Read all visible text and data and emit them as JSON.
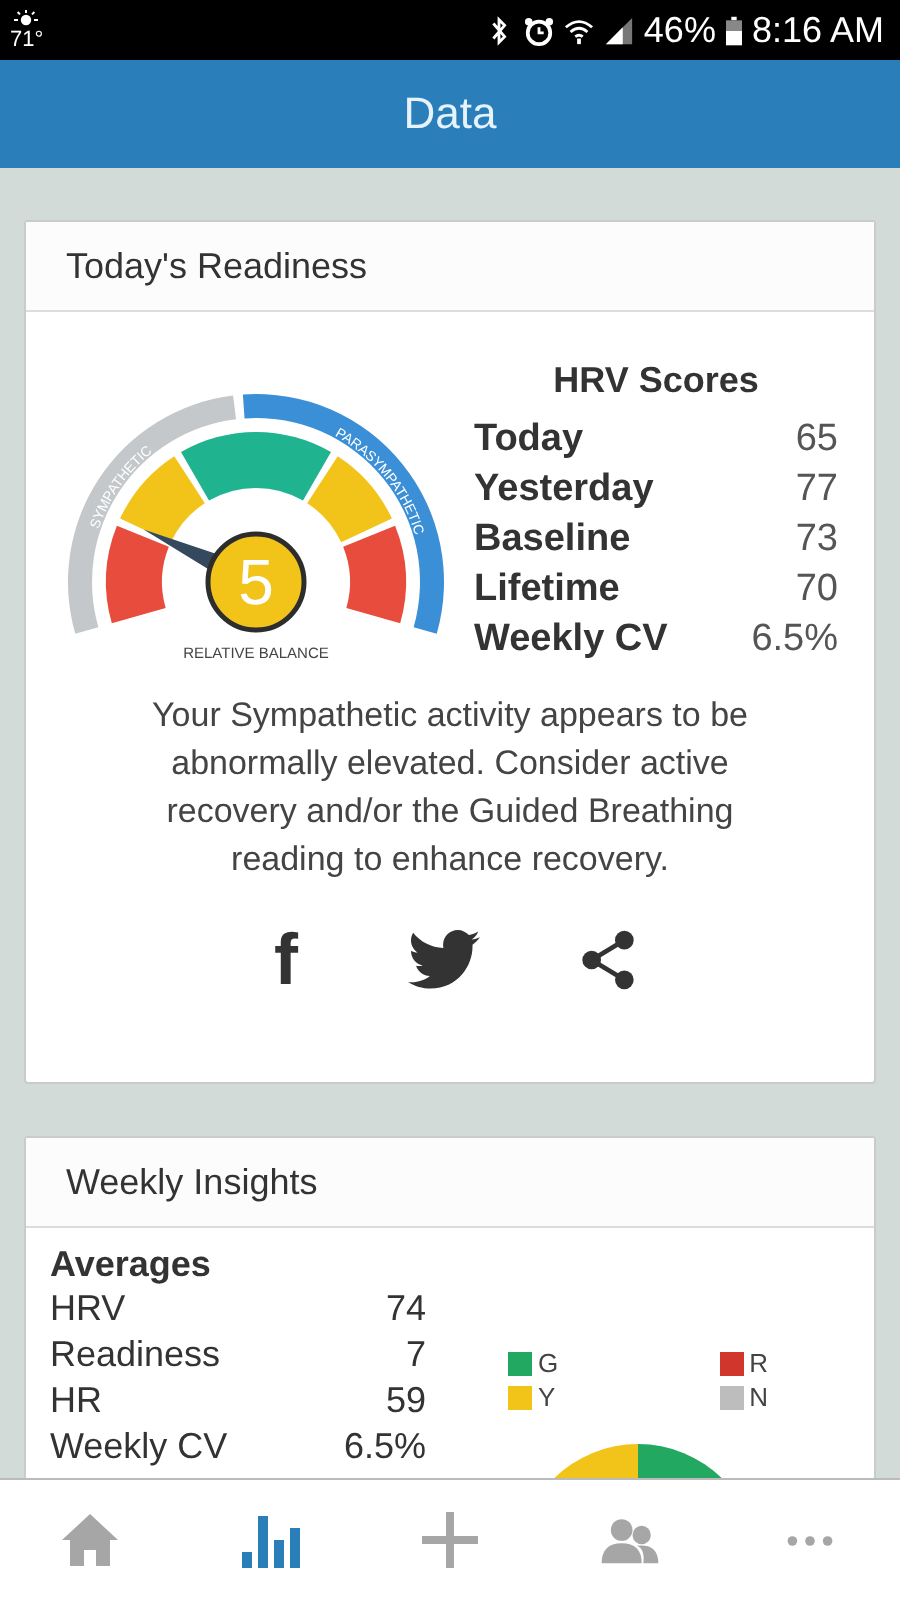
{
  "status_bar": {
    "temperature": "71°",
    "battery": "46%",
    "time": "8:16 AM"
  },
  "header": {
    "title": "Data"
  },
  "readiness": {
    "title": "Today's Readiness",
    "gauge": {
      "value": "5",
      "left_label": "SYMPATHETIC",
      "right_label": "PARASYMPATHETIC",
      "caption": "RELATIVE BALANCE"
    },
    "scores": {
      "title": "HRV Scores",
      "rows": [
        {
          "label": "Today",
          "value": "65"
        },
        {
          "label": "Yesterday",
          "value": "77"
        },
        {
          "label": "Baseline",
          "value": "73"
        },
        {
          "label": "Lifetime",
          "value": "70"
        },
        {
          "label": "Weekly CV",
          "value": "6.5%"
        }
      ]
    },
    "message": "Your Sympathetic activity appears to be abnormally elevated. Consider active recovery and/or the Guided Breathing reading to enhance recovery.",
    "share": [
      {
        "kind": "facebook",
        "glyph": "f"
      },
      {
        "kind": "twitter"
      },
      {
        "kind": "share"
      }
    ]
  },
  "insights": {
    "title": "Weekly Insights",
    "averages": {
      "title": "Averages",
      "rows": [
        {
          "label": "HRV",
          "value": "74"
        },
        {
          "label": "Readiness",
          "value": "7"
        },
        {
          "label": "HR",
          "value": "59"
        },
        {
          "label": "Weekly CV",
          "value": "6.5%"
        }
      ]
    },
    "legend": [
      {
        "label": "G",
        "color": "#22a861"
      },
      {
        "label": "R",
        "color": "#d0362b"
      },
      {
        "label": "Y",
        "color": "#f2c318"
      },
      {
        "label": "N",
        "color": "#bdbdbd"
      }
    ]
  },
  "nav": [
    {
      "kind": "home",
      "selected": false
    },
    {
      "kind": "chart",
      "selected": true
    },
    {
      "kind": "add",
      "selected": false
    },
    {
      "kind": "people",
      "selected": false
    },
    {
      "kind": "more",
      "selected": false
    }
  ]
}
